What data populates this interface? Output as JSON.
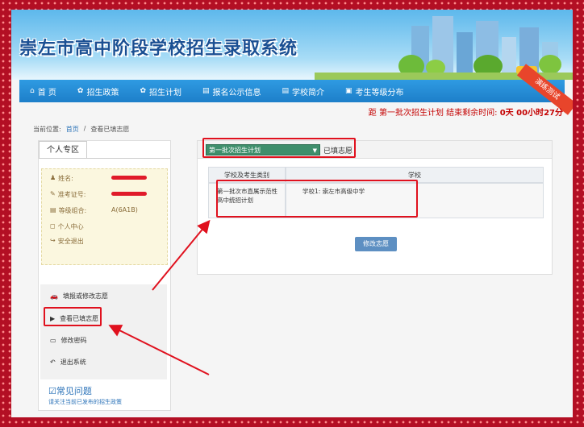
{
  "header": {
    "title": "崇左市高中阶段学校招生录取系统",
    "ribbon": "演练测试"
  },
  "nav": [
    {
      "icon": "home-icon",
      "glyph": "⌂",
      "label": "首 页"
    },
    {
      "icon": "gear-icon",
      "glyph": "✿",
      "label": "招生政策"
    },
    {
      "icon": "gear-icon",
      "glyph": "✿",
      "label": "招生计划"
    },
    {
      "icon": "document-icon",
      "glyph": "▤",
      "label": "报名公示信息"
    },
    {
      "icon": "document-icon",
      "glyph": "▤",
      "label": "学校简介"
    },
    {
      "icon": "image-icon",
      "glyph": "▣",
      "label": "考生等级分布"
    }
  ],
  "countdown": {
    "label": "距 第一批次招生计划 结束剩余时间:",
    "value": "0天 00小时27分"
  },
  "breadcrumb": {
    "prefix": "当前位置:",
    "home": "首页",
    "sep": "/",
    "current": "查看已填志愿"
  },
  "sidebar": {
    "tab": "个人专区",
    "info": [
      {
        "label": "姓名:",
        "value": ""
      },
      {
        "label": "准考证号:",
        "value": ""
      },
      {
        "label": "等级组合:",
        "value": "A(6A1B)"
      }
    ],
    "links": [
      "个人中心",
      "安全退出"
    ],
    "menu": [
      "填报或修改志愿",
      "查看已填志愿",
      "修改密码",
      "退出系统"
    ],
    "faq_title": "常见问题",
    "faq_note": "请关注当前已发布的招生政策"
  },
  "main": {
    "select_value": "第一批次招生计划",
    "select_label": "已填志愿",
    "table": {
      "headers": [
        "学校及考生类别",
        "学校"
      ],
      "rows": [
        {
          "category": "第一批次市直属示范性高中统招计划",
          "school": "学校1:  崇左市高级中学"
        }
      ]
    },
    "edit_button": "修改志愿"
  },
  "colors": {
    "nav": "#1d7fc9",
    "highlight": "#e0111e",
    "select": "#3f8f6c"
  }
}
